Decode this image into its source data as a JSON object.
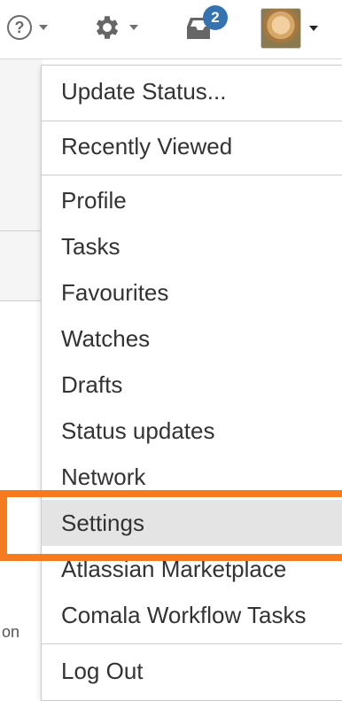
{
  "header": {
    "help_icon_glyph": "?",
    "notification_count": "2"
  },
  "menu": {
    "items": [
      {
        "label": "Update Status..."
      },
      {
        "label": "Recently Viewed"
      },
      {
        "label": "Profile"
      },
      {
        "label": "Tasks"
      },
      {
        "label": "Favourites"
      },
      {
        "label": "Watches"
      },
      {
        "label": "Drafts"
      },
      {
        "label": "Status updates"
      },
      {
        "label": "Network"
      },
      {
        "label": "Settings"
      },
      {
        "label": "Atlassian Marketplace"
      },
      {
        "label": "Comala Workflow Tasks"
      },
      {
        "label": "Log Out"
      }
    ],
    "selected": "Settings"
  },
  "page": {
    "partial_text": "on"
  },
  "colors": {
    "highlight": "#f47b20",
    "badge": "#3572b0",
    "selected_bg": "#e4e4e4"
  }
}
